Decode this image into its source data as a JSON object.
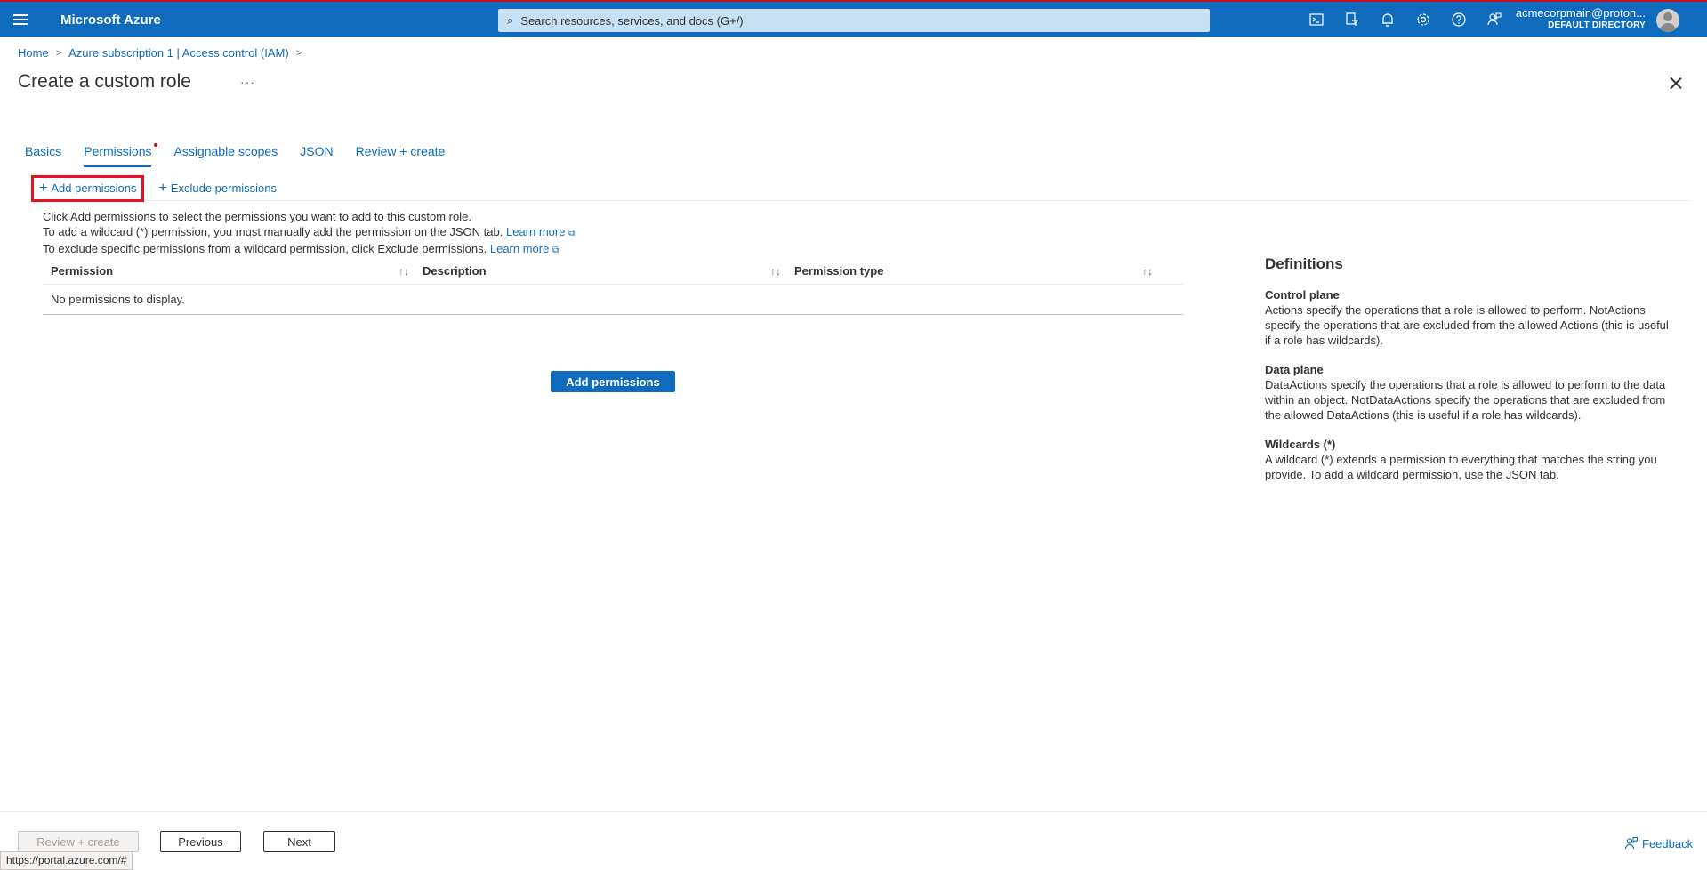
{
  "topbar": {
    "brand": "Microsoft Azure",
    "search_placeholder": "Search resources, services, and docs (G+/)",
    "icons": [
      "cloud-shell-icon",
      "directory-filter-icon",
      "notifications-icon",
      "settings-icon",
      "help-icon",
      "feedback-icon"
    ],
    "account_name": "acmecorpmain@proton...",
    "account_directory": "DEFAULT DIRECTORY"
  },
  "breadcrumb": {
    "items": [
      "Home",
      "Azure subscription 1 | Access control (IAM)"
    ]
  },
  "page": {
    "title": "Create a custom role",
    "more": "···"
  },
  "tabs": [
    {
      "label": "Basics",
      "active": false
    },
    {
      "label": "Permissions",
      "active": true
    },
    {
      "label": "Assignable scopes",
      "active": false
    },
    {
      "label": "JSON",
      "active": false
    },
    {
      "label": "Review + create",
      "active": false
    }
  ],
  "commands": {
    "add": "Add permissions",
    "exclude": "Exclude permissions"
  },
  "info": {
    "line1": "Click Add permissions to select the permissions you want to add to this custom role.",
    "line2": "To add a wildcard (*) permission, you must manually add the permission on the JSON tab.",
    "line3": "To exclude specific permissions from a wildcard permission, click Exclude permissions.",
    "learn_more": "Learn more"
  },
  "table": {
    "columns": [
      "Permission",
      "Description",
      "Permission type"
    ],
    "empty_text": "No permissions to display."
  },
  "add_button": "Add permissions",
  "definitions": {
    "title": "Definitions",
    "sections": [
      {
        "heading": "Control plane",
        "text": "Actions specify the operations that a role is allowed to perform. NotActions specify the operations that are excluded from the allowed Actions (this is useful if a role has wildcards)."
      },
      {
        "heading": "Data plane",
        "text": "DataActions specify the operations that a role is allowed to perform to the data within an object. NotDataActions specify the operations that are excluded from the allowed DataActions (this is useful if a role has wildcards)."
      },
      {
        "heading": "Wildcards (*)",
        "text": "A wildcard (*) extends a permission to everything that matches the string you provide. To add a wildcard permission, use the JSON tab."
      }
    ]
  },
  "footer": {
    "review_create": "Review + create",
    "previous": "Previous",
    "next": "Next",
    "feedback": "Feedback"
  },
  "status_url": "https://portal.azure.com/#",
  "colors": {
    "accent": "#0f6cbd",
    "highlight": "#e81123",
    "required_dot": "#c50f1f"
  }
}
